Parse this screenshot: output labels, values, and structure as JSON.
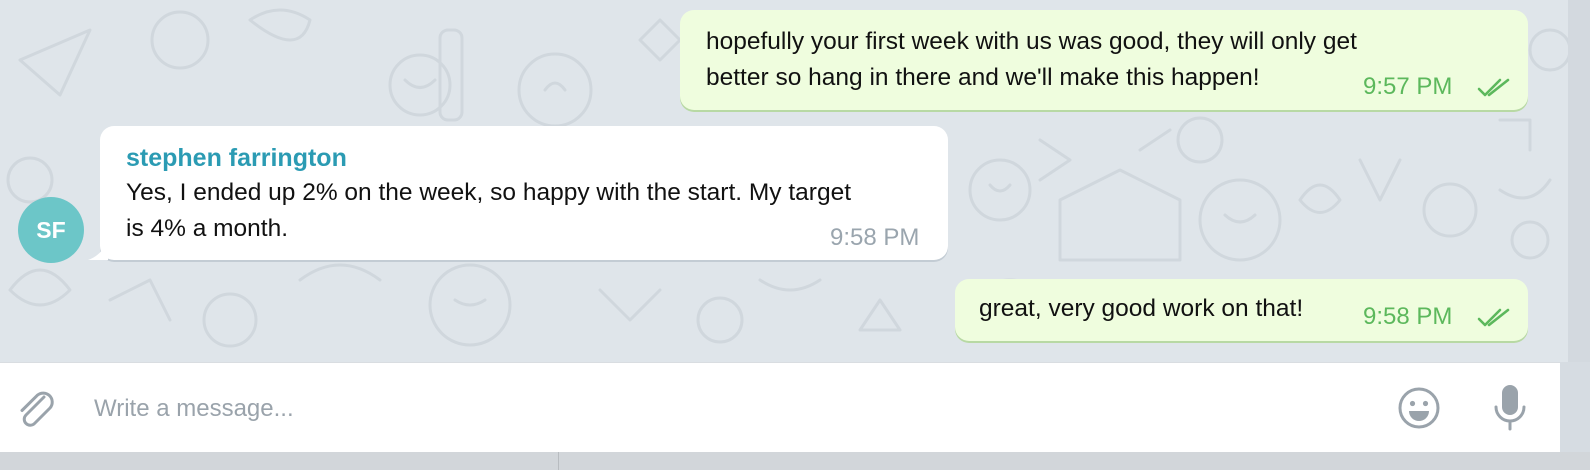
{
  "messages": [
    {
      "direction": "out",
      "lines": [
        "hopefully your first week with us was good, they will only get",
        "better so hang in there and we'll make this happen!"
      ],
      "time": "9:57 PM",
      "status": "read-double-check-icon"
    },
    {
      "direction": "in",
      "sender": "stephen farrington",
      "lines": [
        "Yes, I ended up 2% on the week, so happy with the start. My target",
        "is 4% a month."
      ],
      "time": "9:58 PM"
    },
    {
      "direction": "out",
      "lines": [
        "great, very good work on that!"
      ],
      "time": "9:58 PM",
      "status": "read-double-check-icon"
    }
  ],
  "avatar": {
    "initials": "SF",
    "color": "#6cc6c8"
  },
  "composer": {
    "placeholder": "Write a message...",
    "value": "",
    "attach_icon": "paperclip-icon",
    "emoji_icon": "emoji-icon",
    "voice_icon": "microphone-icon"
  },
  "colors": {
    "outgoing_bubble": "#effdde",
    "incoming_bubble": "#ffffff",
    "sender_name": "#2b9bb3",
    "outgoing_time": "#5cb85c",
    "chat_background": "#dfe5ea"
  }
}
